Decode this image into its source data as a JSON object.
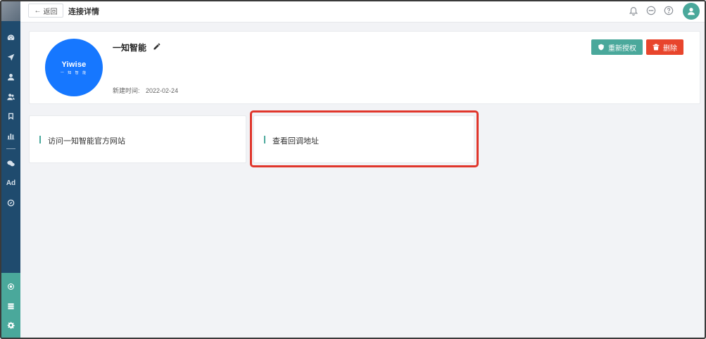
{
  "topbar": {
    "back_label": "返回",
    "page_title": "连接详情"
  },
  "profile": {
    "logo_text": "Yiwise",
    "logo_subtext": "一 知 智 能",
    "name": "一知智能",
    "created_label": "新建时间:",
    "created_date": "2022-02-24",
    "reauth_label": "重新授权",
    "delete_label": "删除"
  },
  "cards": {
    "official_site": "访问一知智能官方网站",
    "callback_url": "查看回调地址"
  },
  "colors": {
    "sidebar": "#1f4b6e",
    "accent": "#4aa89b",
    "danger": "#e8452c",
    "brand_blue": "#1677ff",
    "highlight": "#e0362b"
  },
  "icons": {
    "sidebar": [
      "dashboard-icon",
      "send-icon",
      "user-icon",
      "users-icon",
      "bookmark-icon",
      "bar-chart-icon",
      "wechat-icon",
      "ad-icon",
      "compass-icon"
    ],
    "sidebar_bottom": [
      "plugin-icon",
      "database-icon",
      "settings-icon"
    ],
    "topbar": [
      "bell-icon",
      "message-icon",
      "help-icon",
      "avatar-icon"
    ]
  },
  "sidebar": {
    "ad_label": "Ad"
  }
}
